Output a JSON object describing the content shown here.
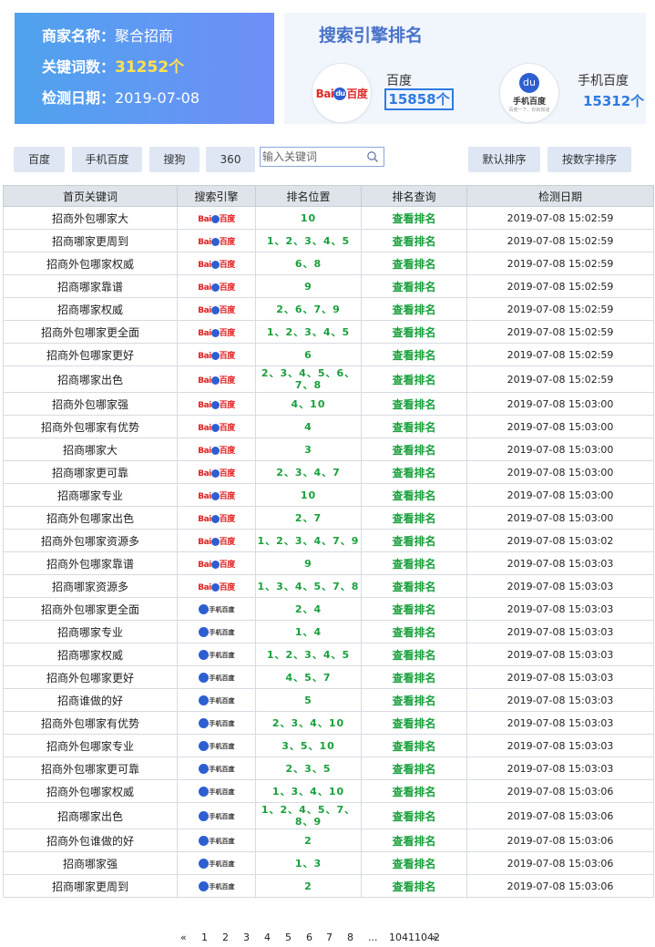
{
  "merchant": {
    "name_label": "商家名称：",
    "name_value": "聚合招商",
    "keywords_label": "关键词数：",
    "keywords_value": "31252个",
    "date_label": "检测日期：",
    "date_value": "2019-07-08"
  },
  "ranking": {
    "title": "搜索引擎排名",
    "baidu": {
      "name": "百度",
      "count": "15858个",
      "logo_text_red": "Bai",
      "logo_text_cn": "百度"
    },
    "mobile_baidu": {
      "name": "手机百度",
      "count": "15312个",
      "logo_text": "手机百度",
      "logo_sub": "百度一下，你就知道"
    }
  },
  "toolbar": {
    "engines": [
      "百度",
      "手机百度",
      "搜狗",
      "360"
    ],
    "search_placeholder": "输入关键词",
    "search_value": "",
    "sort_default": "默认排序",
    "sort_number": "按数字排序"
  },
  "table": {
    "headers": [
      "首页关键词",
      "搜索引擎",
      "排名位置",
      "排名查询",
      "检测日期"
    ],
    "check_label": "查看排名",
    "rows": [
      {
        "keyword": "招商外包哪家大",
        "engine": "baidu",
        "positions": "10",
        "date": "2019-07-08 15:02:59"
      },
      {
        "keyword": "招商哪家更周到",
        "engine": "baidu",
        "positions": "1、2、3、4、5",
        "date": "2019-07-08 15:02:59"
      },
      {
        "keyword": "招商外包哪家权威",
        "engine": "baidu",
        "positions": "6、8",
        "date": "2019-07-08 15:02:59"
      },
      {
        "keyword": "招商哪家靠谱",
        "engine": "baidu",
        "positions": "9",
        "date": "2019-07-08 15:02:59"
      },
      {
        "keyword": "招商哪家权威",
        "engine": "baidu",
        "positions": "2、6、7、9",
        "date": "2019-07-08 15:02:59"
      },
      {
        "keyword": "招商外包哪家更全面",
        "engine": "baidu",
        "positions": "1、2、3、4、5",
        "date": "2019-07-08 15:02:59"
      },
      {
        "keyword": "招商外包哪家更好",
        "engine": "baidu",
        "positions": "6",
        "date": "2019-07-08 15:02:59"
      },
      {
        "keyword": "招商哪家出色",
        "engine": "baidu",
        "positions": "2、3、4、5、6、7、8",
        "date": "2019-07-08 15:02:59"
      },
      {
        "keyword": "招商外包哪家强",
        "engine": "baidu",
        "positions": "4、10",
        "date": "2019-07-08 15:03:00"
      },
      {
        "keyword": "招商外包哪家有优势",
        "engine": "baidu",
        "positions": "4",
        "date": "2019-07-08 15:03:00"
      },
      {
        "keyword": "招商哪家大",
        "engine": "baidu",
        "positions": "3",
        "date": "2019-07-08 15:03:00"
      },
      {
        "keyword": "招商哪家更可靠",
        "engine": "baidu",
        "positions": "2、3、4、7",
        "date": "2019-07-08 15:03:00"
      },
      {
        "keyword": "招商哪家专业",
        "engine": "baidu",
        "positions": "10",
        "date": "2019-07-08 15:03:00"
      },
      {
        "keyword": "招商外包哪家出色",
        "engine": "baidu",
        "positions": "2、7",
        "date": "2019-07-08 15:03:00"
      },
      {
        "keyword": "招商外包哪家资源多",
        "engine": "baidu",
        "positions": "1、2、3、4、7、9",
        "date": "2019-07-08 15:03:02"
      },
      {
        "keyword": "招商外包哪家靠谱",
        "engine": "baidu",
        "positions": "9",
        "date": "2019-07-08 15:03:03"
      },
      {
        "keyword": "招商哪家资源多",
        "engine": "baidu",
        "positions": "1、3、4、5、7、8",
        "date": "2019-07-08 15:03:03"
      },
      {
        "keyword": "招商外包哪家更全面",
        "engine": "mobile",
        "positions": "2、4",
        "date": "2019-07-08 15:03:03"
      },
      {
        "keyword": "招商哪家专业",
        "engine": "mobile",
        "positions": "1、4",
        "date": "2019-07-08 15:03:03"
      },
      {
        "keyword": "招商哪家权威",
        "engine": "mobile",
        "positions": "1、2、3、4、5",
        "date": "2019-07-08 15:03:03"
      },
      {
        "keyword": "招商外包哪家更好",
        "engine": "mobile",
        "positions": "4、5、7",
        "date": "2019-07-08 15:03:03"
      },
      {
        "keyword": "招商谁做的好",
        "engine": "mobile",
        "positions": "5",
        "date": "2019-07-08 15:03:03"
      },
      {
        "keyword": "招商外包哪家有优势",
        "engine": "mobile",
        "positions": "2、3、4、10",
        "date": "2019-07-08 15:03:03"
      },
      {
        "keyword": "招商外包哪家专业",
        "engine": "mobile",
        "positions": "3、5、10",
        "date": "2019-07-08 15:03:03"
      },
      {
        "keyword": "招商外包哪家更可靠",
        "engine": "mobile",
        "positions": "2、3、5",
        "date": "2019-07-08 15:03:03"
      },
      {
        "keyword": "招商外包哪家权威",
        "engine": "mobile",
        "positions": "1、3、4、10",
        "date": "2019-07-08 15:03:06"
      },
      {
        "keyword": "招商哪家出色",
        "engine": "mobile",
        "positions": "1、2、4、5、7、8、9",
        "date": "2019-07-08 15:03:06"
      },
      {
        "keyword": "招商外包谁做的好",
        "engine": "mobile",
        "positions": "2",
        "date": "2019-07-08 15:03:06"
      },
      {
        "keyword": "招商哪家强",
        "engine": "mobile",
        "positions": "1、3",
        "date": "2019-07-08 15:03:06"
      },
      {
        "keyword": "招商哪家更周到",
        "engine": "mobile",
        "positions": "2",
        "date": "2019-07-08 15:03:06"
      }
    ]
  },
  "pagination": {
    "prev": "«",
    "pages": [
      "1",
      "2",
      "3",
      "4",
      "5",
      "6",
      "7",
      "8"
    ],
    "ellipsis": "...",
    "last": "10411042",
    "next": "»"
  },
  "colors": {
    "accent": "#4873c9",
    "rank_green": "#19a03c",
    "highlight_yellow": "#ffe14d",
    "count_blue": "#2f7be0"
  }
}
